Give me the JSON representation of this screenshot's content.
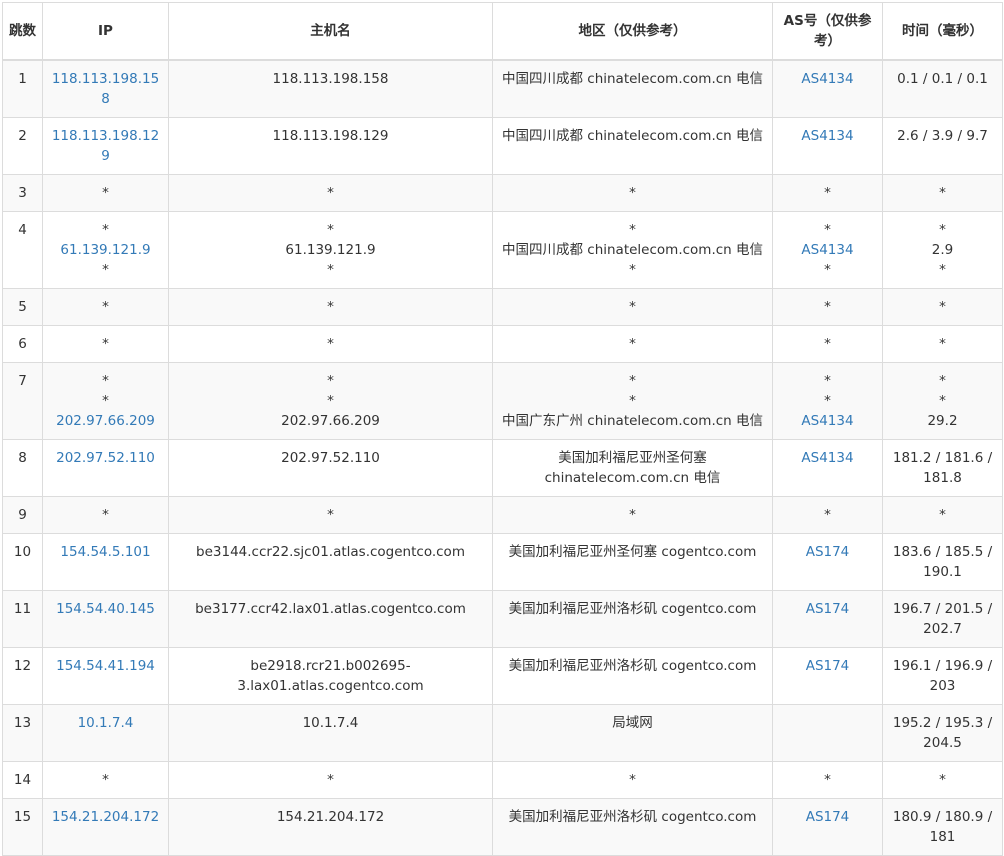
{
  "headers": [
    "跳数",
    "IP",
    "主机名",
    "地区（仅供参考）",
    "AS号（仅供参考）",
    "时间（毫秒）"
  ],
  "hops": [
    {
      "hop": "1",
      "ip": [
        "118.113.198.158"
      ],
      "hostname": [
        "118.113.198.158"
      ],
      "region": [
        "中国四川成都 chinatelecom.com.cn 电信"
      ],
      "asn": [
        "AS4134"
      ],
      "time": [
        "0.1 / 0.1 / 0.1"
      ]
    },
    {
      "hop": "2",
      "ip": [
        "118.113.198.129"
      ],
      "hostname": [
        "118.113.198.129"
      ],
      "region": [
        "中国四川成都 chinatelecom.com.cn 电信"
      ],
      "asn": [
        "AS4134"
      ],
      "time": [
        "2.6 / 3.9 / 9.7"
      ]
    },
    {
      "hop": "3",
      "ip": [
        "*"
      ],
      "hostname": [
        "*"
      ],
      "region": [
        "*"
      ],
      "asn": [
        "*"
      ],
      "time": [
        "*"
      ]
    },
    {
      "hop": "4",
      "ip": [
        "*",
        "61.139.121.9",
        "*"
      ],
      "hostname": [
        "*",
        "61.139.121.9",
        "*"
      ],
      "region": [
        "*",
        "中国四川成都 chinatelecom.com.cn 电信",
        "*"
      ],
      "asn": [
        "*",
        "AS4134",
        "*"
      ],
      "time": [
        "*",
        "2.9",
        "*"
      ]
    },
    {
      "hop": "5",
      "ip": [
        "*"
      ],
      "hostname": [
        "*"
      ],
      "region": [
        "*"
      ],
      "asn": [
        "*"
      ],
      "time": [
        "*"
      ]
    },
    {
      "hop": "6",
      "ip": [
        "*"
      ],
      "hostname": [
        "*"
      ],
      "region": [
        "*"
      ],
      "asn": [
        "*"
      ],
      "time": [
        "*"
      ]
    },
    {
      "hop": "7",
      "ip": [
        "*",
        "*",
        "202.97.66.209"
      ],
      "hostname": [
        "*",
        "*",
        "202.97.66.209"
      ],
      "region": [
        "*",
        "*",
        "中国广东广州 chinatelecom.com.cn 电信"
      ],
      "asn": [
        "*",
        "*",
        "AS4134"
      ],
      "time": [
        "*",
        "*",
        "29.2"
      ]
    },
    {
      "hop": "8",
      "ip": [
        "202.97.52.110"
      ],
      "hostname": [
        "202.97.52.110"
      ],
      "region": [
        "美国加利福尼亚州圣何塞",
        "chinatelecom.com.cn 电信"
      ],
      "asn": [
        "AS4134"
      ],
      "time": [
        "181.2 / 181.6 /",
        "181.8"
      ]
    },
    {
      "hop": "9",
      "ip": [
        "*"
      ],
      "hostname": [
        "*"
      ],
      "region": [
        "*"
      ],
      "asn": [
        "*"
      ],
      "time": [
        "*"
      ]
    },
    {
      "hop": "10",
      "ip": [
        "154.54.5.101"
      ],
      "hostname": [
        "be3144.ccr22.sjc01.atlas.cogentco.com"
      ],
      "region": [
        "美国加利福尼亚州圣何塞 cogentco.com"
      ],
      "asn": [
        "AS174"
      ],
      "time": [
        "183.6 / 185.5 /",
        "190.1"
      ]
    },
    {
      "hop": "11",
      "ip": [
        "154.54.40.145"
      ],
      "hostname": [
        "be3177.ccr42.lax01.atlas.cogentco.com"
      ],
      "region": [
        "美国加利福尼亚州洛杉矶 cogentco.com"
      ],
      "asn": [
        "AS174"
      ],
      "time": [
        "196.7 / 201.5 /",
        "202.7"
      ]
    },
    {
      "hop": "12",
      "ip": [
        "154.54.41.194"
      ],
      "hostname": [
        "be2918.rcr21.b002695-",
        "3.lax01.atlas.cogentco.com"
      ],
      "region": [
        "美国加利福尼亚州洛杉矶 cogentco.com"
      ],
      "asn": [
        "AS174"
      ],
      "time": [
        "196.1 / 196.9 /",
        "203"
      ]
    },
    {
      "hop": "13",
      "ip": [
        "10.1.7.4"
      ],
      "hostname": [
        "10.1.7.4"
      ],
      "region": [
        "局域网"
      ],
      "asn": [
        ""
      ],
      "time": [
        "195.2 / 195.3 /",
        "204.5"
      ]
    },
    {
      "hop": "14",
      "ip": [
        "*"
      ],
      "hostname": [
        "*"
      ],
      "region": [
        "*"
      ],
      "asn": [
        "*"
      ],
      "time": [
        "*"
      ]
    },
    {
      "hop": "15",
      "ip": [
        "154.21.204.172"
      ],
      "hostname": [
        "154.21.204.172"
      ],
      "region": [
        "美国加利福尼亚州洛杉矶 cogentco.com"
      ],
      "asn": [
        "AS174"
      ],
      "time": [
        "180.9 / 180.9 /",
        "181"
      ]
    }
  ],
  "colors": {
    "link": "#337ab7",
    "stripe": "#f9f9f9",
    "border": "#dcdcdc",
    "text": "#333333"
  }
}
